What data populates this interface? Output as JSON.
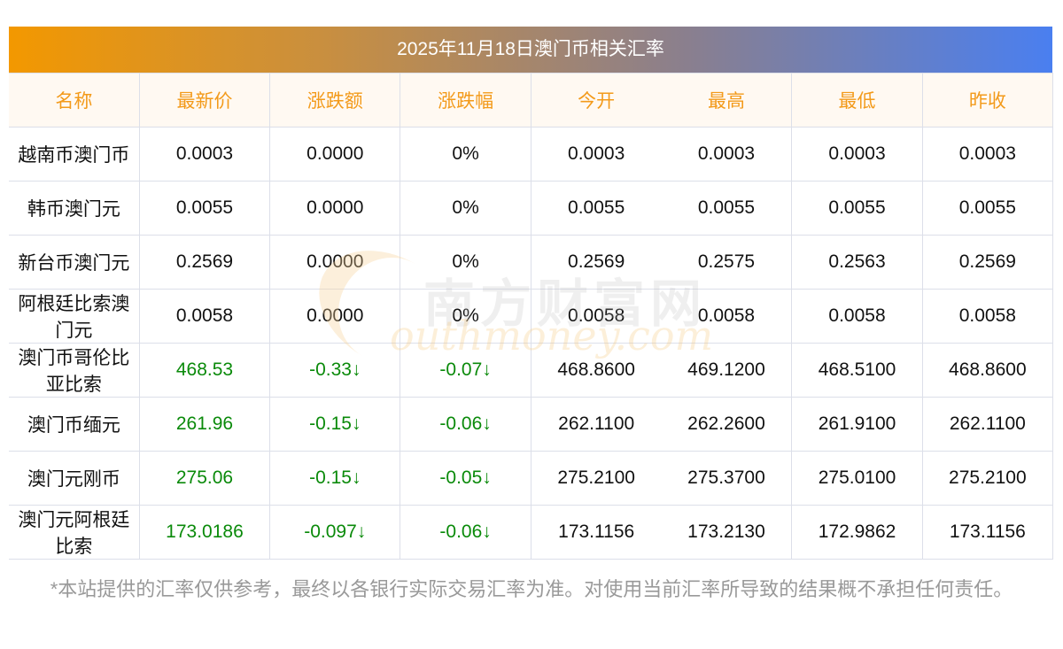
{
  "title": "2025年11月18日澳门币相关汇率",
  "columns": [
    "名称",
    "最新价",
    "涨跌额",
    "涨跌幅",
    "今开",
    "最高",
    "最低",
    "昨收"
  ],
  "rows": [
    {
      "name": "越南币澳门币",
      "latest": "0.0003",
      "change": "0.0000",
      "pct": "0%",
      "open": "0.0003",
      "high": "0.0003",
      "low": "0.0003",
      "prev": "0.0003",
      "down": false
    },
    {
      "name": "韩币澳门元",
      "latest": "0.0055",
      "change": "0.0000",
      "pct": "0%",
      "open": "0.0055",
      "high": "0.0055",
      "low": "0.0055",
      "prev": "0.0055",
      "down": false
    },
    {
      "name": "新台币澳门元",
      "latest": "0.2569",
      "change": "0.0000",
      "pct": "0%",
      "open": "0.2569",
      "high": "0.2575",
      "low": "0.2563",
      "prev": "0.2569",
      "down": false
    },
    {
      "name": "阿根廷比索澳门元",
      "latest": "0.0058",
      "change": "0.0000",
      "pct": "0%",
      "open": "0.0058",
      "high": "0.0058",
      "low": "0.0058",
      "prev": "0.0058",
      "down": false
    },
    {
      "name": "澳门币哥伦比亚比索",
      "latest": "468.53",
      "change": "-0.33↓",
      "pct": "-0.07↓",
      "open": "468.8600",
      "high": "469.1200",
      "low": "468.5100",
      "prev": "468.8600",
      "down": true
    },
    {
      "name": "澳门币缅元",
      "latest": "261.96",
      "change": "-0.15↓",
      "pct": "-0.06↓",
      "open": "262.1100",
      "high": "262.2600",
      "low": "261.9100",
      "prev": "262.1100",
      "down": true
    },
    {
      "name": "澳门元刚币",
      "latest": "275.06",
      "change": "-0.15↓",
      "pct": "-0.05↓",
      "open": "275.2100",
      "high": "275.3700",
      "low": "275.0100",
      "prev": "275.2100",
      "down": true
    },
    {
      "name": "澳门元阿根廷比索",
      "latest": "173.0186",
      "change": "-0.097↓",
      "pct": "-0.06↓",
      "open": "173.1156",
      "high": "173.2130",
      "low": "172.9862",
      "prev": "173.1156",
      "down": true
    }
  ],
  "footer": "*本站提供的汇率仅供参考，最终以各银行实际交易汇率为准。对使用当前汇率所导致的结果概不承担任何责任。",
  "watermark": {
    "cn": "南方财富网",
    "en": "outhmoney.com"
  },
  "colors": {
    "header_text": "#f39a1a",
    "down": "#0a8a0a"
  }
}
